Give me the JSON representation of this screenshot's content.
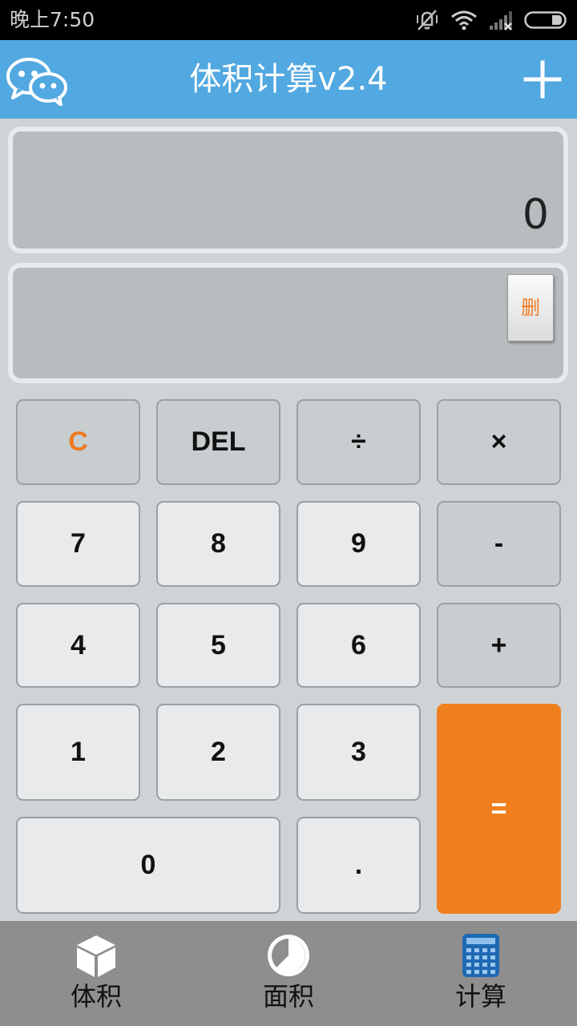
{
  "status": {
    "time": "晚上7:50"
  },
  "header": {
    "title": "体积计算v2.4"
  },
  "display": {
    "value": "0"
  },
  "history": {
    "delete_label": "删"
  },
  "keys": {
    "clear": "C",
    "del": "DEL",
    "divide": "÷",
    "multiply": "×",
    "seven": "7",
    "eight": "8",
    "nine": "9",
    "minus": "-",
    "four": "4",
    "five": "5",
    "six": "6",
    "plus": "+",
    "one": "1",
    "two": "2",
    "three": "3",
    "equals": "=",
    "zero": "0",
    "dot": "."
  },
  "tabs": [
    {
      "label": "体积",
      "icon": "cube-icon"
    },
    {
      "label": "面积",
      "icon": "pie-icon"
    },
    {
      "label": "计算",
      "icon": "calculator-icon"
    }
  ],
  "colors": {
    "header": "#52a8e0",
    "accent": "#f07f1f",
    "active_tab": "#1f68b4"
  }
}
